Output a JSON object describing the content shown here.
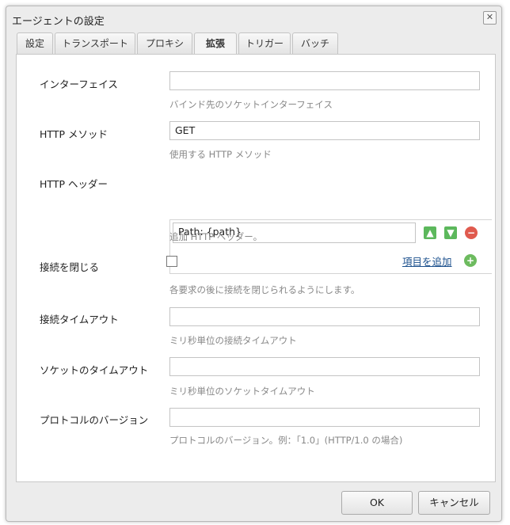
{
  "window": {
    "title": "エージェントの設定"
  },
  "tabs": [
    {
      "label": "設定"
    },
    {
      "label": "トランスポート"
    },
    {
      "label": "プロキシ"
    },
    {
      "label": "拡張",
      "active": true
    },
    {
      "label": "トリガー"
    },
    {
      "label": "バッチ"
    }
  ],
  "fields": {
    "interface": {
      "label": "インターフェイス",
      "value": "",
      "help": "バインド先のソケットインターフェイス"
    },
    "method": {
      "label": "HTTP メソッド",
      "value": "GET",
      "help": "使用する HTTP メソッド"
    },
    "headers": {
      "label": "HTTP ヘッダー",
      "items": [
        {
          "value": "Path: {path}"
        }
      ],
      "add_label": "項目を追加",
      "help": "追加 HTTP ヘッダー。"
    },
    "close_conn": {
      "label": "接続を閉じる",
      "checked": false,
      "help": "各要求の後に接続を閉じられるようにします。"
    },
    "conn_timeout": {
      "label": "接続タイムアウト",
      "value": "",
      "help": "ミリ秒単位の接続タイムアウト"
    },
    "socket_timeout": {
      "label": "ソケットのタイムアウト",
      "value": "",
      "help": "ミリ秒単位のソケットタイムアウト"
    },
    "protocol": {
      "label": "プロトコルのバージョン",
      "value": "",
      "help": "プロトコルのバージョン。例：「1.0」(HTTP/1.0 の場合)"
    }
  },
  "footer": {
    "ok": "OK",
    "cancel": "キャンセル"
  }
}
